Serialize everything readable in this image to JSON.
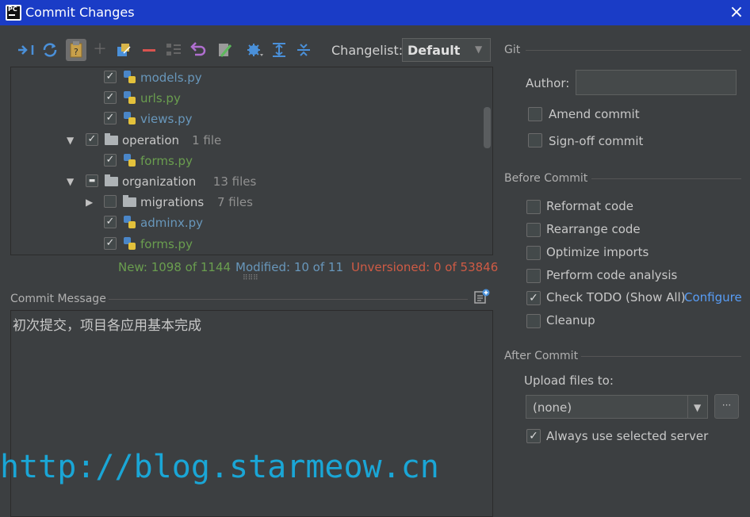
{
  "window": {
    "title": "Commit Changes",
    "icon": "pycharm-app-icon",
    "close": "×"
  },
  "toolbar": {
    "icons": [
      "show-diff-icon",
      "refresh-icon",
      "jump-to-source-icon",
      "add-icon",
      "move-to-changelist-icon",
      "remove-icon",
      "group-by-icon",
      "revert-icon",
      "edit-source-icon",
      "settings-gear-icon",
      "expand-all-icon",
      "collapse-all-icon"
    ],
    "changelist_label": "Changelist:",
    "changelist_value": "Default"
  },
  "tree": [
    {
      "name": "models.py",
      "type": "file",
      "color": "blue",
      "checked": "checked"
    },
    {
      "name": "urls.py",
      "type": "file",
      "color": "green",
      "checked": "checked"
    },
    {
      "name": "views.py",
      "type": "file",
      "color": "blue",
      "checked": "checked"
    },
    {
      "name": "operation",
      "type": "folder",
      "count": "1 file",
      "expanded": "down",
      "checked": "checked"
    },
    {
      "name": "forms.py",
      "type": "file",
      "color": "green",
      "checked": "checked"
    },
    {
      "name": "organization",
      "type": "folder",
      "count": "13 files",
      "expanded": "down",
      "checked": "partial"
    },
    {
      "name": "migrations",
      "type": "folder",
      "count": "7 files",
      "expanded": "right",
      "checked": "unchecked"
    },
    {
      "name": "adminx.py",
      "type": "file",
      "color": "blue",
      "checked": "checked"
    },
    {
      "name": "forms.py",
      "type": "file",
      "color": "green",
      "checked": "checked"
    }
  ],
  "summary": {
    "new": "New: 1098 of 1144",
    "modified": "Modified: 10 of 11",
    "unversioned": "Unversioned: 0 of 53846"
  },
  "commit_message": {
    "label": "Commit Message",
    "text": "初次提交，项目各应用基本完成"
  },
  "watermark": "http://blog.starmeow.cn",
  "git": {
    "title": "Git",
    "author_label": "Author:",
    "author_value": "",
    "amend_commit": "Amend commit",
    "sign_off_commit": "Sign-off commit"
  },
  "before_commit": {
    "title": "Before Commit",
    "options": [
      {
        "label": "Reformat code",
        "checked": false
      },
      {
        "label": "Rearrange code",
        "checked": false
      },
      {
        "label": "Optimize imports",
        "checked": false
      },
      {
        "label": "Perform code analysis",
        "checked": false
      },
      {
        "label": "Check TODO (Show All)",
        "checked": true
      },
      {
        "label": "Cleanup",
        "checked": false
      }
    ],
    "configure_link": "Configure"
  },
  "after_commit": {
    "title": "After Commit",
    "upload_label": "Upload files to:",
    "upload_value": "(none)",
    "browse_label": "···",
    "always_use_server": "Always use selected server",
    "always_use_checked": true
  },
  "colors": {
    "titlebar": "#1a3cc6",
    "background": "#3c3f41",
    "new_green": "#6a9e4f",
    "modified_blue": "#6897bb",
    "unversioned_red": "#cf5b45",
    "link": "#589df6",
    "watermark": "#1aa6d6"
  }
}
